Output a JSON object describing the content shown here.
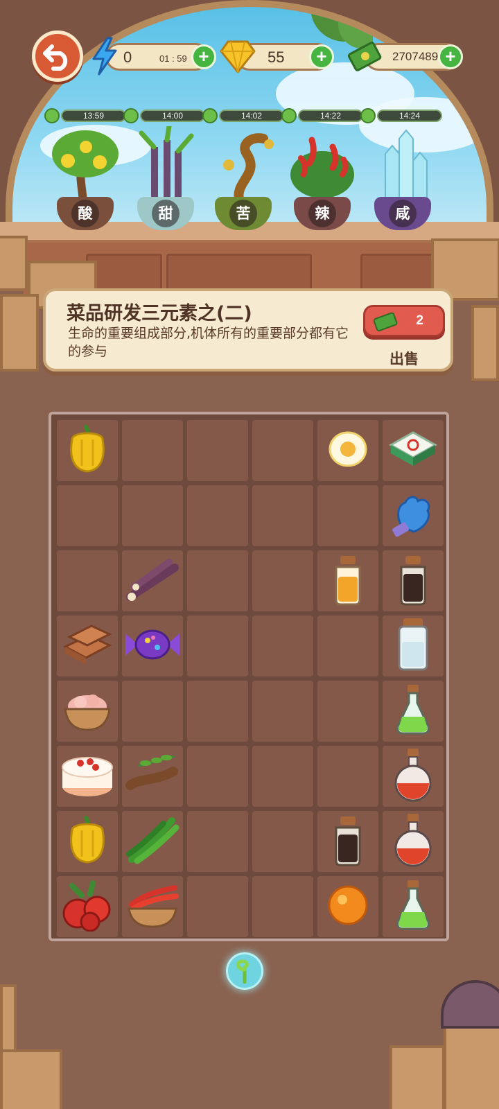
{
  "hud": {
    "energy": {
      "value": "0",
      "timer": "01 : 59"
    },
    "gems": {
      "value": "55"
    },
    "cash": {
      "value": "2707489"
    }
  },
  "plants": [
    {
      "timer": "13:59",
      "label": "酸",
      "pot_color": "#7a4f3b",
      "name": "lemon-tree"
    },
    {
      "timer": "14:00",
      "label": "甜",
      "pot_color": "#9ec7c8",
      "name": "sugarcane"
    },
    {
      "timer": "14:02",
      "label": "苦",
      "pot_color": "#6e8a33",
      "name": "bitter-tree"
    },
    {
      "timer": "14:22",
      "label": "辣",
      "pot_color": "#7a4a48",
      "name": "chili-plant"
    },
    {
      "timer": "14:24",
      "label": "咸",
      "pot_color": "#6a4a8e",
      "name": "salt-crystal"
    }
  ],
  "info": {
    "title": "菜品研发三元素之(二)",
    "description": "生命的重要组成部分,机体所有的重要部分都有它的参与",
    "sell_count": "2",
    "sell_label": "出售"
  },
  "grid": {
    "rows": [
      [
        "yellow-pepper",
        "",
        "",
        "",
        "fried-egg",
        "mahjong-tile"
      ],
      [
        "",
        "",
        "",
        "",
        "",
        "blue-glove"
      ],
      [
        "",
        "sugarcane",
        "",
        "",
        "honey-jar",
        "soy-sauce-jar"
      ],
      [
        "toast",
        "candy",
        "",
        "",
        "",
        "salt-jar"
      ],
      [
        "meat-bowl",
        "",
        "",
        "",
        "",
        "green-potion"
      ],
      [
        "cake",
        "tamarind",
        "",
        "",
        "",
        "red-potion"
      ],
      [
        "yellow-pepper",
        "green-chili",
        "",
        "",
        "soy-sauce-jar",
        "red-potion"
      ],
      [
        "red-berries",
        "chili-bowl",
        "",
        "",
        "orange-orb",
        "green-potion"
      ]
    ]
  },
  "colors": {
    "accent_green": "#46b441",
    "sell_red": "#e15b4f",
    "back_orange": "#d85a35"
  }
}
